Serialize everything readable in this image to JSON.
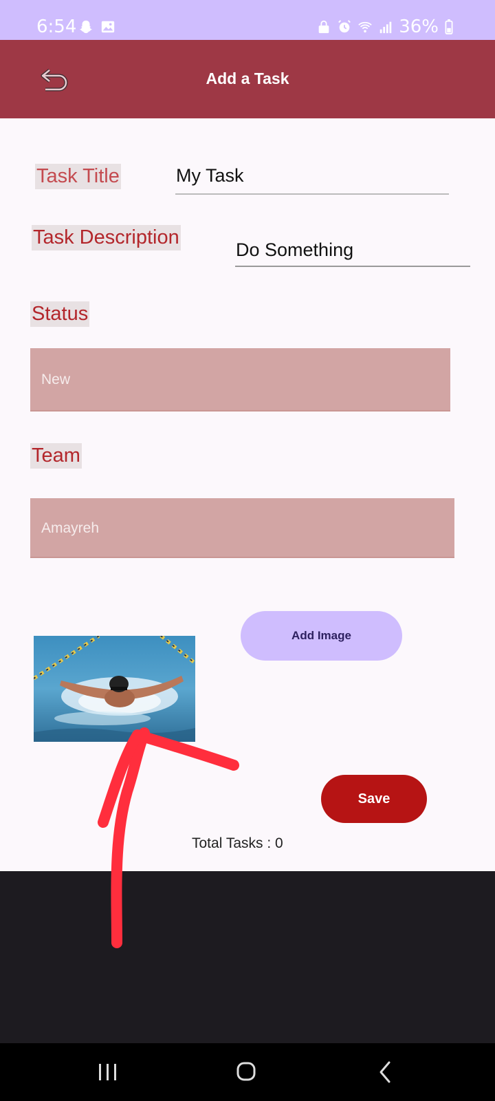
{
  "status_bar": {
    "time": "6:54",
    "battery": "36%",
    "left_icons": [
      "snapchat-icon",
      "image-icon"
    ],
    "right_icons": [
      "lock-icon",
      "alarm-icon",
      "wifi-icon",
      "signal-icon",
      "battery-icon"
    ]
  },
  "app_bar": {
    "title": "Add a Task",
    "back_icon": "undo-icon"
  },
  "form": {
    "task_title_label": "Task Title",
    "task_title_value": "My Task",
    "task_description_label": "Task Description",
    "task_description_value": "Do Something",
    "status_label": "Status",
    "status_value": "New",
    "team_label": "Team",
    "team_value": "Amayreh"
  },
  "buttons": {
    "add_image": "Add Image",
    "save": "Save"
  },
  "footer": {
    "total_tasks": "Total Tasks : 0"
  },
  "colors": {
    "status_bar": "#cfbdfe",
    "app_bar": "#9e3845",
    "save_button": "#b61414",
    "add_image_button": "#cfbdfe",
    "dropdown": "#d2a5a4",
    "annotation_arrow": "#ff2e3d"
  },
  "nav_bar": {
    "icons": [
      "recents-icon",
      "home-icon",
      "back-icon"
    ]
  }
}
